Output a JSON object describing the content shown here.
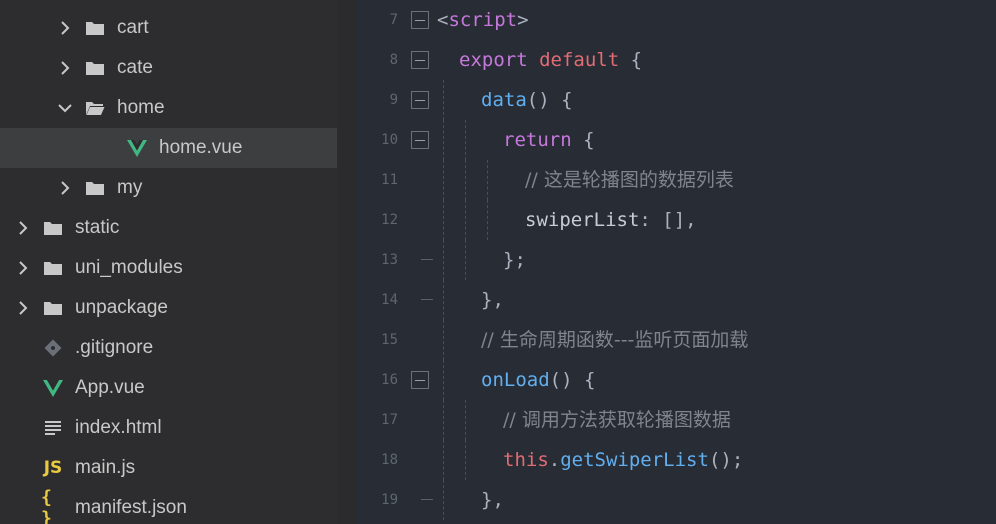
{
  "file_tree": [
    {
      "label": "cart",
      "type": "folder",
      "expanded": false,
      "depth": 2
    },
    {
      "label": "cate",
      "type": "folder",
      "expanded": false,
      "depth": 2
    },
    {
      "label": "home",
      "type": "folder",
      "expanded": true,
      "depth": 2
    },
    {
      "label": "home.vue",
      "type": "vue",
      "depth": 3,
      "selected": true
    },
    {
      "label": "my",
      "type": "folder",
      "expanded": false,
      "depth": 2
    },
    {
      "label": "static",
      "type": "folder",
      "expanded": false,
      "depth": 1
    },
    {
      "label": "uni_modules",
      "type": "folder",
      "expanded": false,
      "depth": 1
    },
    {
      "label": "unpackage",
      "type": "folder",
      "expanded": false,
      "depth": 1
    },
    {
      "label": ".gitignore",
      "type": "git",
      "depth": 1
    },
    {
      "label": "App.vue",
      "type": "vue",
      "depth": 1
    },
    {
      "label": "index.html",
      "type": "html",
      "depth": 1
    },
    {
      "label": "main.js",
      "type": "js",
      "depth": 1
    },
    {
      "label": "manifest.json",
      "type": "json",
      "depth": 1
    }
  ],
  "icons": {
    "js_glyph": "JS",
    "json_glyph": "{ }"
  },
  "colors": {
    "vue_green": "#41b883",
    "folder_grey": "#c8c8c8",
    "keyword": "#c678dd",
    "function": "#61afef",
    "comment": "#7f848e",
    "this": "#e06c75"
  },
  "code_lines": [
    {
      "num": "7",
      "fold": "box",
      "indent": 0,
      "tokens": [
        {
          "t": "<",
          "c": "punct"
        },
        {
          "t": "script",
          "c": "tag"
        },
        {
          "t": ">",
          "c": "punct"
        }
      ]
    },
    {
      "num": "8",
      "fold": "box",
      "indent": 1,
      "tokens": [
        {
          "t": "export",
          "c": "kw"
        },
        {
          "t": " ",
          "c": "punct"
        },
        {
          "t": "default",
          "c": "this"
        },
        {
          "t": " {",
          "c": "punct"
        }
      ]
    },
    {
      "num": "9",
      "fold": "box",
      "indent": 2,
      "tokens": [
        {
          "t": "data",
          "c": "fn"
        },
        {
          "t": "() {",
          "c": "punct"
        }
      ]
    },
    {
      "num": "10",
      "fold": "box",
      "indent": 3,
      "tokens": [
        {
          "t": "return",
          "c": "kw"
        },
        {
          "t": " {",
          "c": "punct"
        }
      ]
    },
    {
      "num": "11",
      "fold": "none",
      "indent": 4,
      "tokens": [
        {
          "t": "// 这是轮播图的数据列表",
          "c": "cm"
        }
      ]
    },
    {
      "num": "12",
      "fold": "none",
      "indent": 4,
      "tokens": [
        {
          "t": "swiperList",
          "c": "prop"
        },
        {
          "t": ": [],",
          "c": "punct"
        }
      ]
    },
    {
      "num": "13",
      "fold": "end",
      "indent": 3,
      "tokens": [
        {
          "t": "};",
          "c": "punct"
        }
      ]
    },
    {
      "num": "14",
      "fold": "end",
      "indent": 2,
      "tokens": [
        {
          "t": "},",
          "c": "punct"
        }
      ]
    },
    {
      "num": "15",
      "fold": "none",
      "indent": 2,
      "tokens": [
        {
          "t": "// 生命周期函数---监听页面加载",
          "c": "cm"
        }
      ]
    },
    {
      "num": "16",
      "fold": "box",
      "indent": 2,
      "tokens": [
        {
          "t": "onLoad",
          "c": "fn"
        },
        {
          "t": "() {",
          "c": "punct"
        }
      ]
    },
    {
      "num": "17",
      "fold": "none",
      "indent": 3,
      "tokens": [
        {
          "t": "// 调用方法获取轮播图数据",
          "c": "cm"
        }
      ]
    },
    {
      "num": "18",
      "fold": "none",
      "indent": 3,
      "tokens": [
        {
          "t": "this",
          "c": "this"
        },
        {
          "t": ".",
          "c": "punct"
        },
        {
          "t": "getSwiperList",
          "c": "fn"
        },
        {
          "t": "();",
          "c": "punct"
        }
      ]
    },
    {
      "num": "19",
      "fold": "end",
      "indent": 2,
      "tokens": [
        {
          "t": "},",
          "c": "punct"
        }
      ]
    }
  ]
}
